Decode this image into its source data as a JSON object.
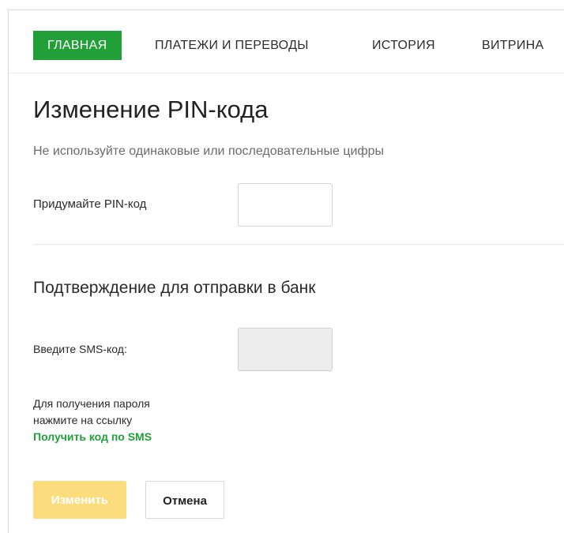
{
  "nav": {
    "items": [
      {
        "label": "ГЛАВНАЯ",
        "active": true
      },
      {
        "label": "ПЛАТЕЖИ И ПЕРЕВОДЫ",
        "active": false
      },
      {
        "label": "ИСТОРИЯ",
        "active": false
      },
      {
        "label": "ВИТРИНА",
        "active": false
      }
    ]
  },
  "form": {
    "title": "Изменение PIN-кода",
    "hint": "Не используйте одинаковые или последовательные цифры",
    "pin_label": "Придумайте PIN-код",
    "pin_value": "",
    "confirm_title": "Подтверждение для отправки в банк",
    "sms_label": "Введите SMS-код:",
    "sms_value": "",
    "help_line1": "Для получения пароля",
    "help_line2": "нажмите на ссылку",
    "sms_link": "Получить код по SMS",
    "submit_label": "Изменить",
    "cancel_label": "Отмена"
  },
  "colors": {
    "accent": "#21a038",
    "submit_disabled": "#fbdd7e"
  }
}
